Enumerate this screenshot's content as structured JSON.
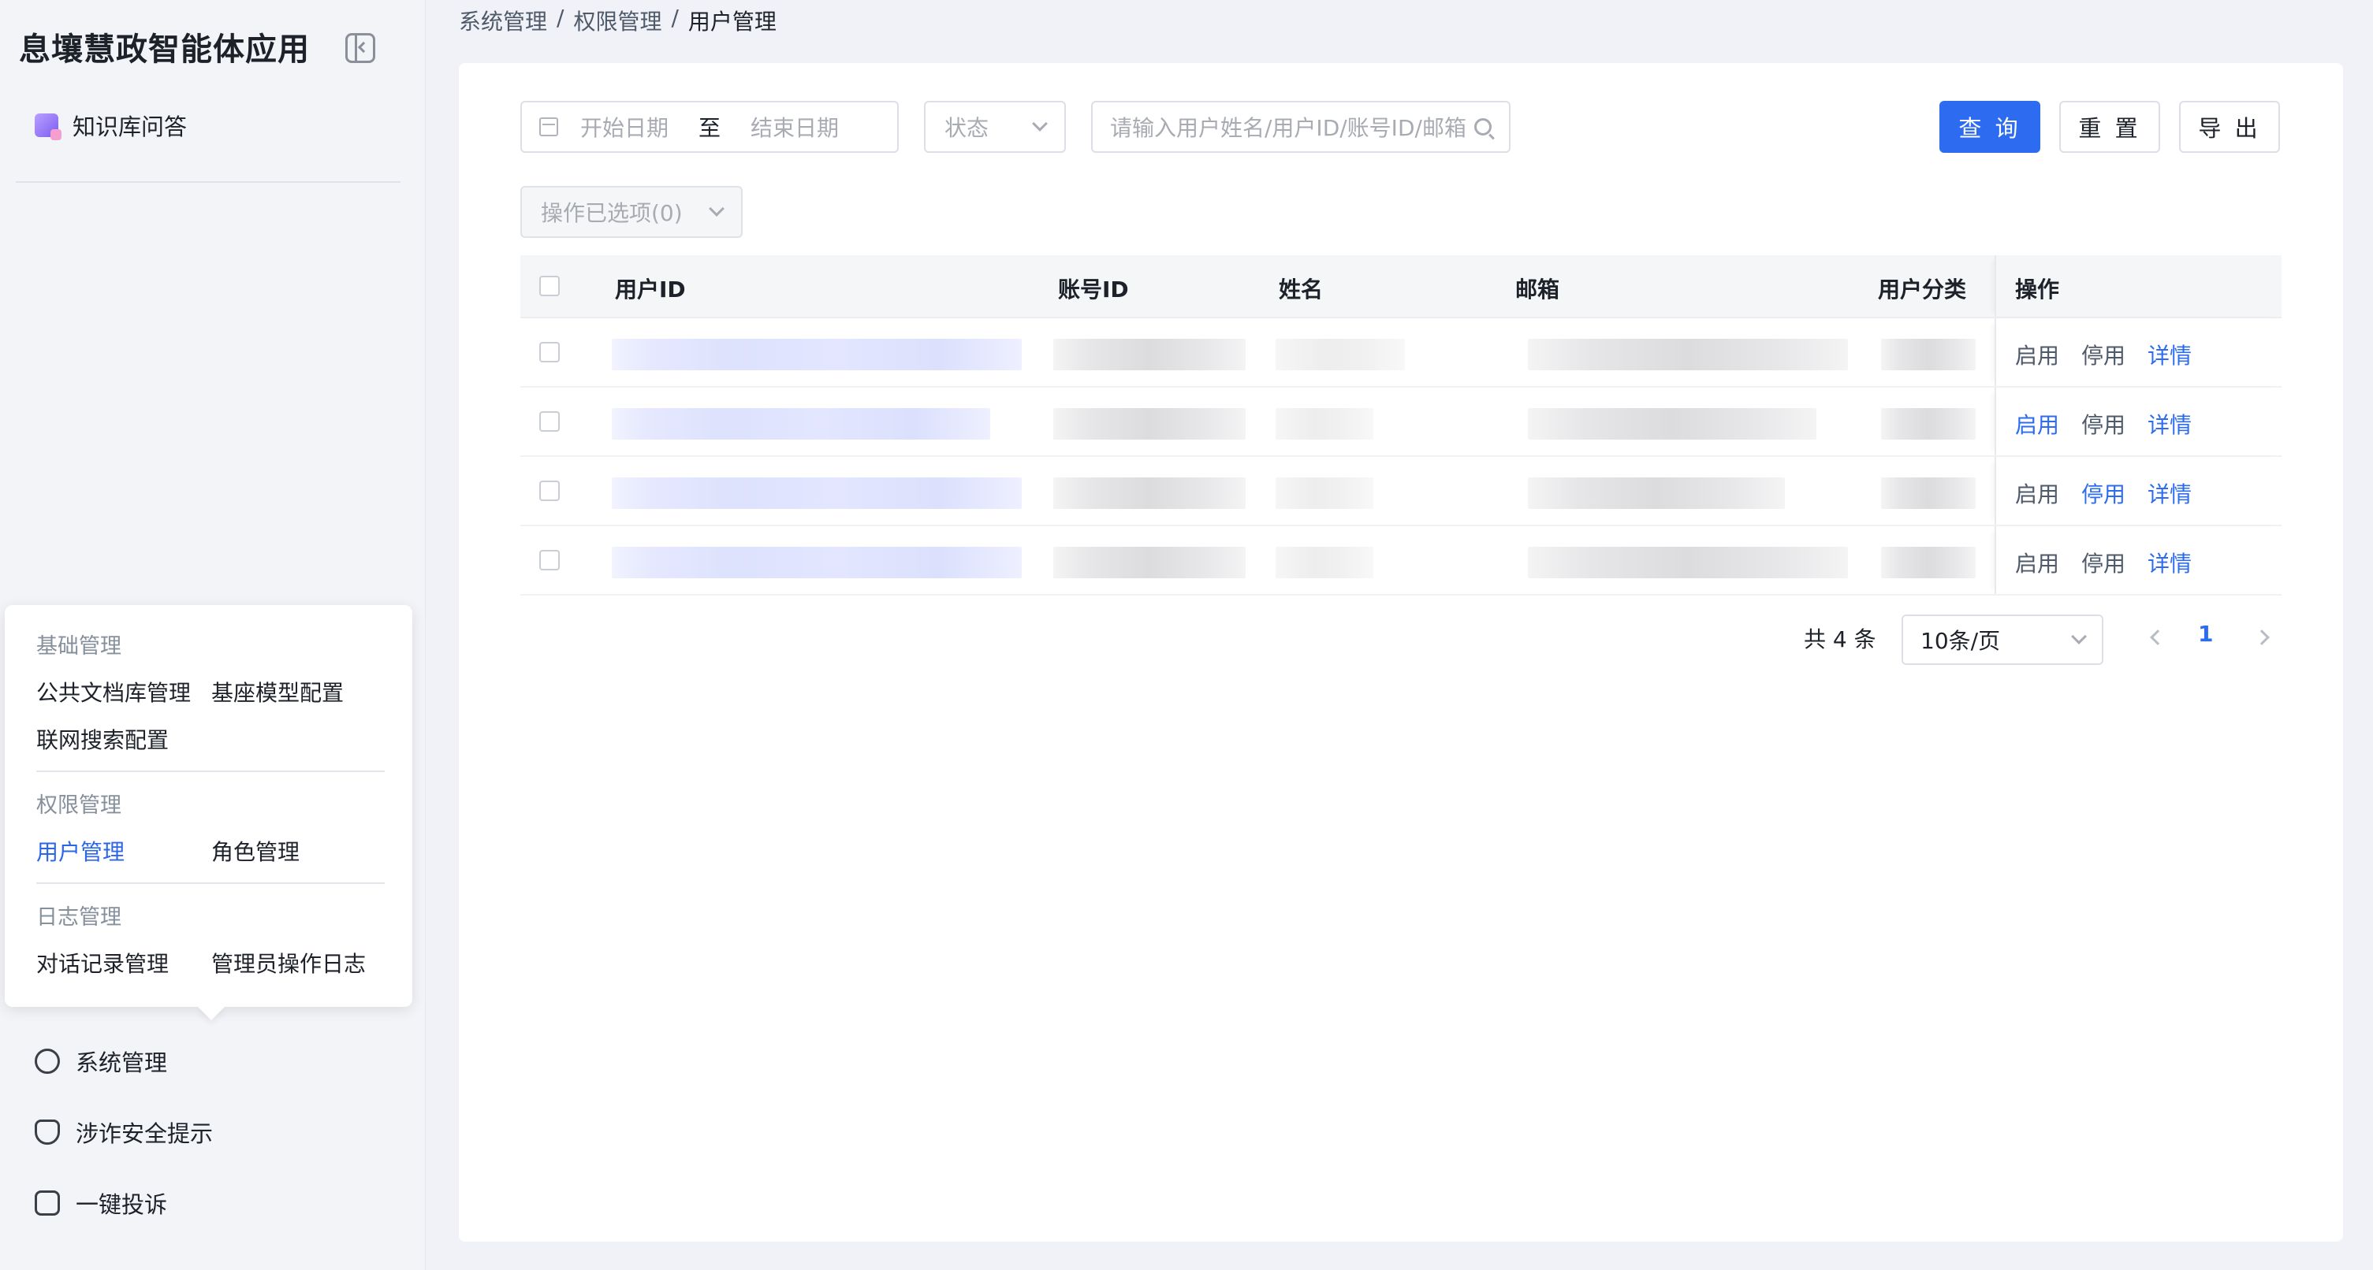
{
  "app": {
    "title": "息壤慧政智能体应用"
  },
  "sidebar": {
    "knowledge_item": "知识库问答",
    "popup": {
      "groups": [
        {
          "title": "基础管理",
          "items": [
            "公共文档库管理",
            "基座模型配置",
            "联网搜索配置"
          ]
        },
        {
          "title": "权限管理",
          "items": [
            "用户管理",
            "角色管理"
          ]
        },
        {
          "title": "日志管理",
          "items": [
            "对话记录管理",
            "管理员操作日志"
          ]
        }
      ],
      "active_item": "用户管理"
    },
    "links": [
      "系统管理",
      "涉诈安全提示",
      "一键投诉"
    ]
  },
  "breadcrumb": [
    "系统管理",
    "/",
    "权限管理",
    "/",
    "用户管理"
  ],
  "filters": {
    "start_placeholder": "开始日期",
    "range_separator": "至",
    "end_placeholder": "结束日期",
    "status_placeholder": "状态",
    "search_placeholder": "请输入用户姓名/用户ID/账号ID/邮箱",
    "query_button": "查 询",
    "reset_button": "重 置",
    "export_button": "导 出",
    "batch_select": "操作已选项(0)"
  },
  "table": {
    "columns": [
      "用户ID",
      "账号ID",
      "姓名",
      "邮箱",
      "用户分类",
      "操作"
    ],
    "rows": [
      {
        "actions": [
          "启用",
          "停用",
          "详情"
        ],
        "active_link": [
          false,
          false,
          true
        ]
      },
      {
        "actions": [
          "启用",
          "停用",
          "详情"
        ],
        "active_link": [
          true,
          false,
          true
        ]
      },
      {
        "actions": [
          "启用",
          "停用",
          "详情"
        ],
        "active_link": [
          false,
          true,
          true
        ]
      },
      {
        "actions": [
          "启用",
          "停用",
          "详情"
        ],
        "active_link": [
          false,
          false,
          true
        ]
      }
    ]
  },
  "pagination": {
    "total": "共 4 条",
    "page_size": "10条/页",
    "current_page": "1"
  },
  "colors": {
    "primary": "#2d6cf0",
    "background": "#f0f2f7",
    "muted_text": "#86909c"
  }
}
